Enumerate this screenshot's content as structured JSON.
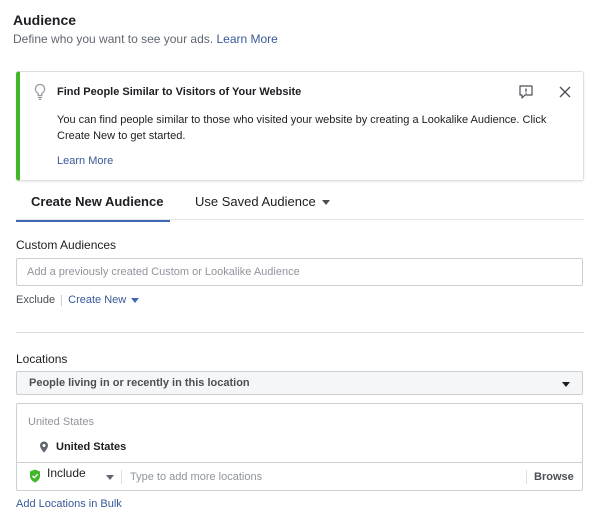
{
  "header": {
    "title": "Audience",
    "description": "Define who you want to see your ads.",
    "learn_more": "Learn More"
  },
  "banner": {
    "title": "Find People Similar to Visitors of Your Website",
    "text": "You can find people similar to those who visited your website by creating a Lookalike Audience. Click Create New to get started.",
    "learn_more": "Learn More",
    "accent_color": "#42b72a"
  },
  "tabs": [
    {
      "label": "Create New Audience",
      "active": true
    },
    {
      "label": "Use Saved Audience",
      "active": false
    }
  ],
  "custom_audiences": {
    "label": "Custom Audiences",
    "placeholder": "Add a previously created Custom or Lookalike Audience",
    "exclude": "Exclude",
    "create_new": "Create New"
  },
  "locations": {
    "label": "Locations",
    "selected_option": "People living in or recently in this location",
    "group": "United States",
    "item": "United States",
    "include": "Include",
    "input_placeholder": "Type to add more locations",
    "browse": "Browse",
    "bulk": "Add Locations in Bulk"
  },
  "colors": {
    "link": "#385898",
    "tab_underline": "#4267b2"
  }
}
